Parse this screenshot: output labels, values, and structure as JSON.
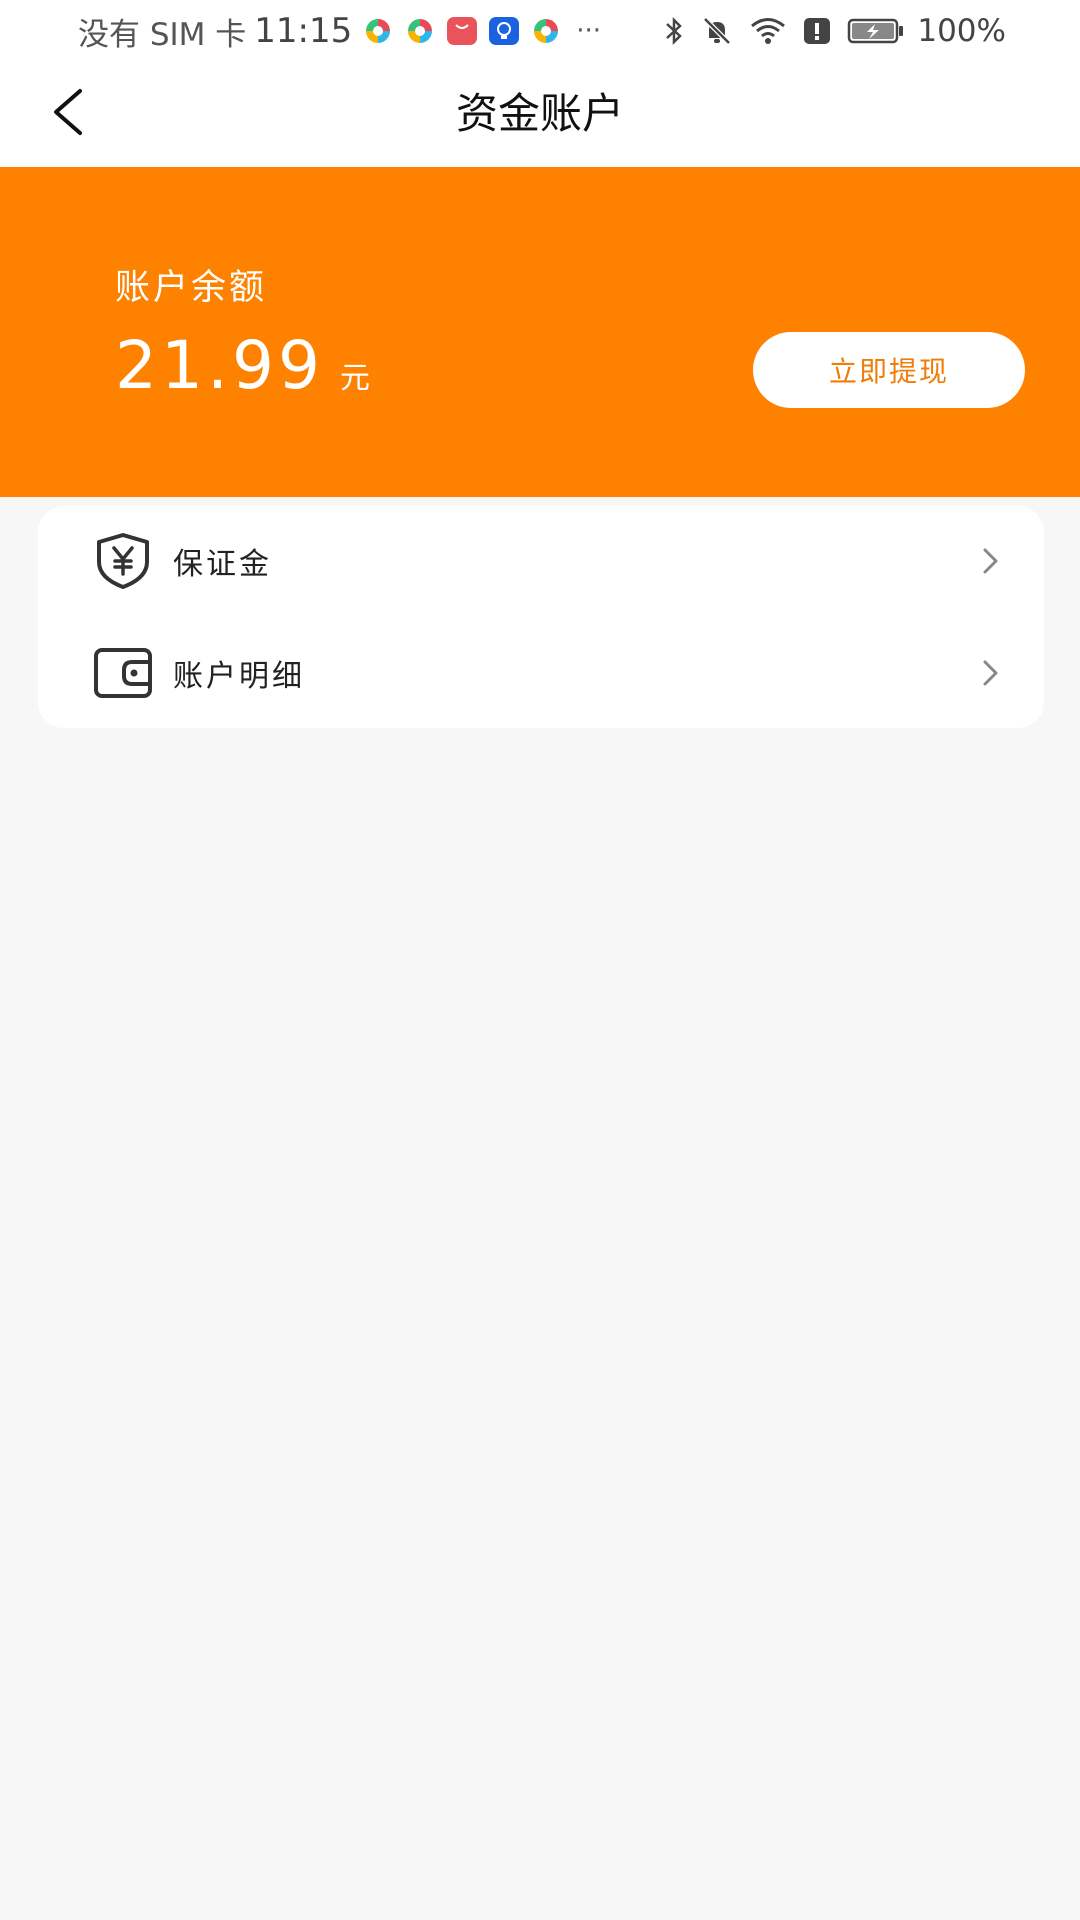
{
  "status_bar": {
    "carrier": "没有 SIM 卡",
    "time": "11:15",
    "overflow": "···",
    "battery": "100%"
  },
  "nav": {
    "title": "资金账户"
  },
  "balance": {
    "label": "账户余额",
    "amount": "21.99",
    "unit": "元",
    "withdraw_label": "立即提现"
  },
  "menu": {
    "items": [
      {
        "label": "保证金",
        "icon": "shield-yen-icon"
      },
      {
        "label": "账户明细",
        "icon": "wallet-icon"
      }
    ]
  },
  "colors": {
    "accent": "#fe8100",
    "button_text": "#f07d0a",
    "background": "#f7f7f7"
  }
}
